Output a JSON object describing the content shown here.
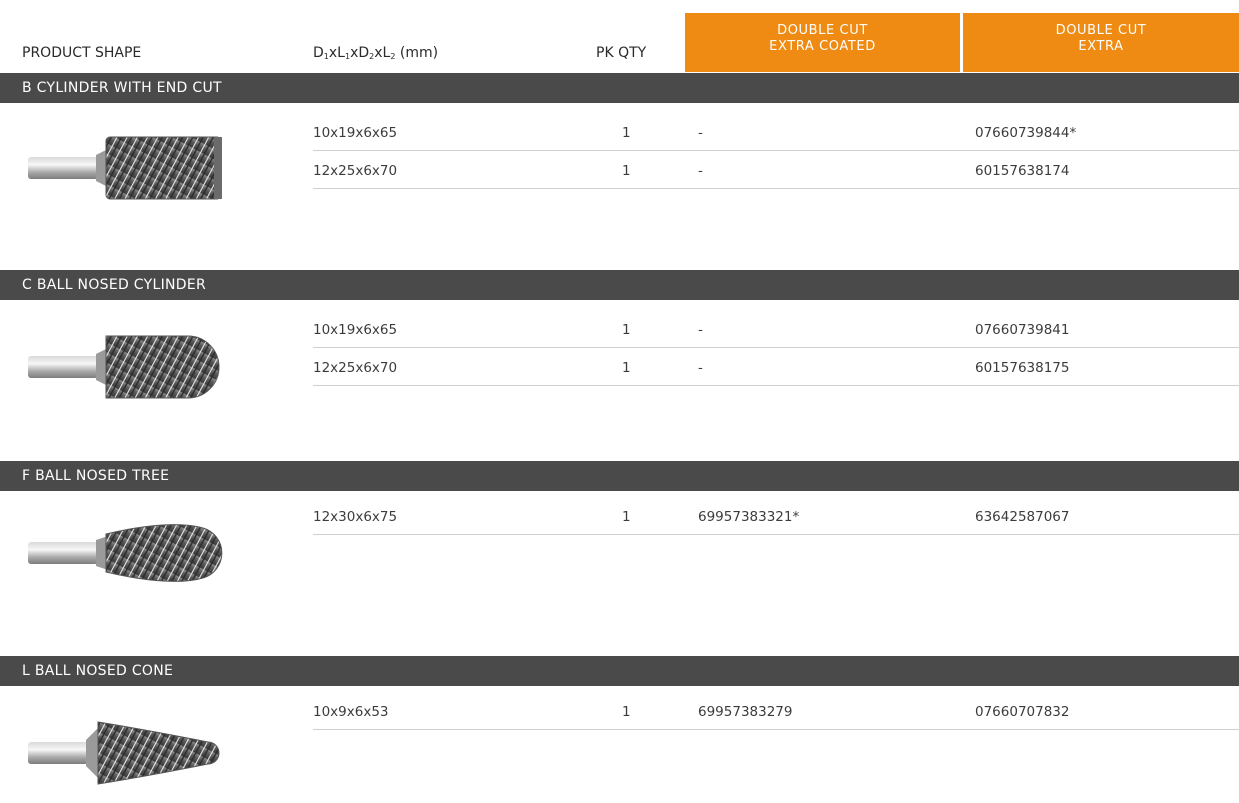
{
  "header": {
    "product_shape": "PRODUCT SHAPE",
    "dims_label": {
      "d1": "D",
      "s1": "1",
      "l1": "xL",
      "s2": "1",
      "d2": "xD",
      "s3": "2",
      "l2": "xL",
      "s4": "2",
      "unit": " (mm)"
    },
    "pk_qty": "PK QTY",
    "col_coated": {
      "line1": "DOUBLE CUT",
      "line2": "EXTRA COATED"
    },
    "col_extra": {
      "line1": "DOUBLE CUT",
      "line2": "EXTRA"
    }
  },
  "sections": [
    {
      "title": "B CYLINDER WITH END CUT",
      "shape_icon": "cylinder-end-cut-burr",
      "rows": [
        {
          "dims": "10x19x6x65",
          "pk": "1",
          "coated": "-",
          "extra": "07660739844*"
        },
        {
          "dims": "12x25x6x70",
          "pk": "1",
          "coated": "-",
          "extra": "60157638174"
        }
      ]
    },
    {
      "title": "C BALL NOSED CYLINDER",
      "shape_icon": "ball-nosed-cylinder-burr",
      "rows": [
        {
          "dims": "10x19x6x65",
          "pk": "1",
          "coated": "-",
          "extra": "07660739841"
        },
        {
          "dims": "12x25x6x70",
          "pk": "1",
          "coated": "-",
          "extra": "60157638175"
        }
      ]
    },
    {
      "title": "F BALL NOSED TREE",
      "shape_icon": "ball-nosed-tree-burr",
      "rows": [
        {
          "dims": "12x30x6x75",
          "pk": "1",
          "coated": "69957383321*",
          "extra": "63642587067"
        }
      ]
    },
    {
      "title": "L BALL NOSED CONE",
      "shape_icon": "ball-nosed-cone-burr",
      "rows": [
        {
          "dims": "10x9x6x53",
          "pk": "1",
          "coated": "69957383279",
          "extra": "07660707832"
        }
      ]
    }
  ],
  "colors": {
    "accent": "#ef8a12",
    "section_bar": "#4a4a4a"
  }
}
